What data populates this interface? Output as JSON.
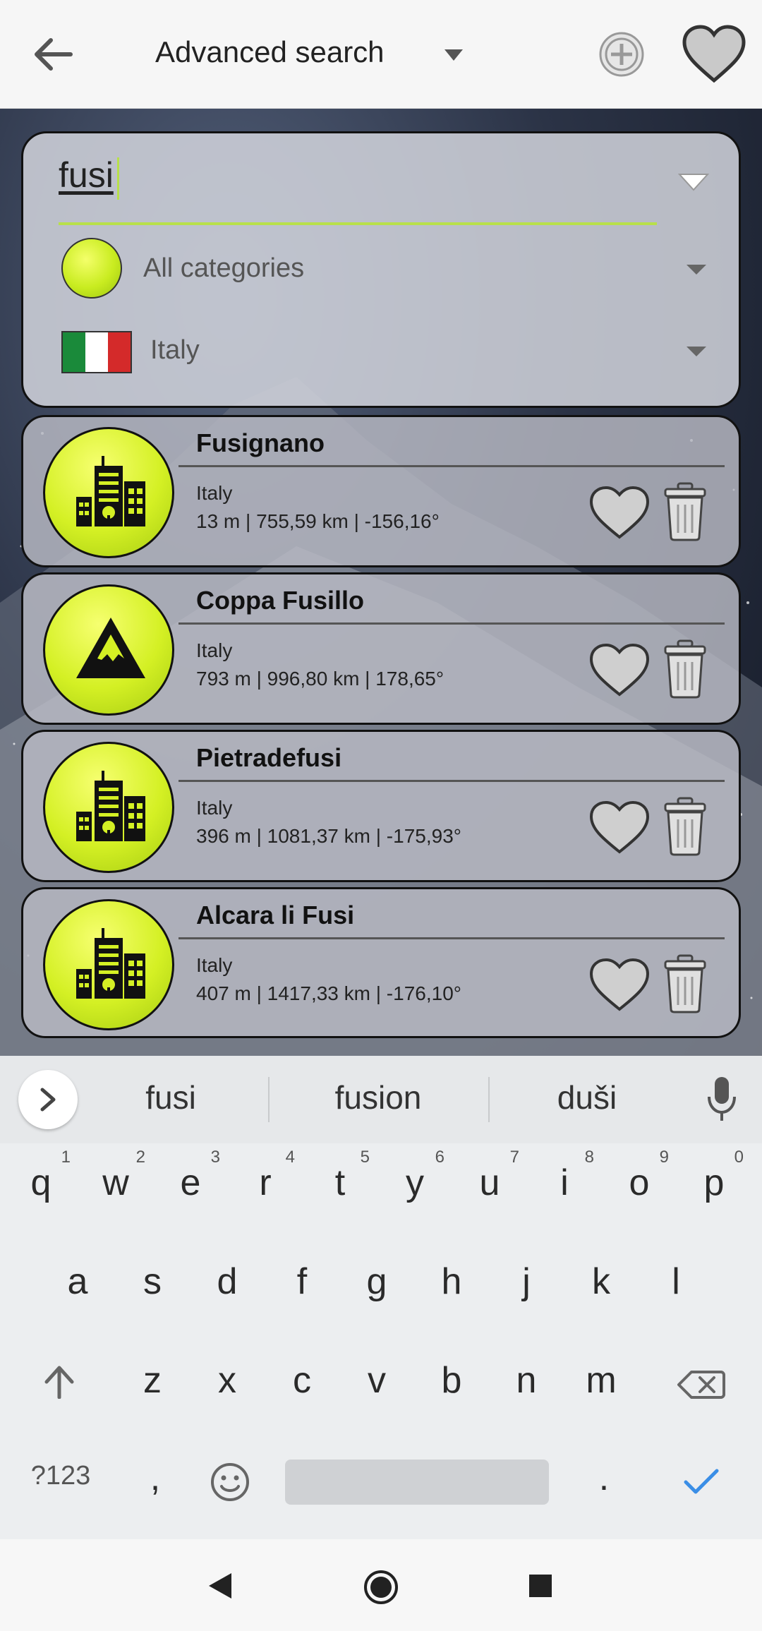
{
  "appbar": {
    "title": "Advanced search",
    "icons": [
      "back-arrow-icon",
      "caret-down-icon",
      "add-circle-icon",
      "heart-icon"
    ]
  },
  "search": {
    "query": "fusi",
    "category": "All categories",
    "country": "Italy",
    "accent_color": "#b8e04a"
  },
  "results": [
    {
      "name": "Fusignano",
      "country": "Italy",
      "details": "13 m | 755,59 km | -156,16°",
      "icon": "city-icon"
    },
    {
      "name": "Coppa Fusillo",
      "country": "Italy",
      "details": "793 m | 996,80 km | 178,65°",
      "icon": "mountain-icon"
    },
    {
      "name": "Pietradefusi",
      "country": "Italy",
      "details": "396 m | 1081,37 km | -175,93°",
      "icon": "city-icon"
    },
    {
      "name": "Alcara li Fusi",
      "country": "Italy",
      "details": "407 m | 1417,33 km | -176,10°",
      "icon": "city-icon"
    }
  ],
  "keyboard": {
    "suggestions": [
      "fusi",
      "fusion",
      "duši"
    ],
    "row1": [
      "q",
      "w",
      "e",
      "r",
      "t",
      "y",
      "u",
      "i",
      "o",
      "p"
    ],
    "row1_nums": [
      "1",
      "2",
      "3",
      "4",
      "5",
      "6",
      "7",
      "8",
      "9",
      "0"
    ],
    "row2": [
      "a",
      "s",
      "d",
      "f",
      "g",
      "h",
      "j",
      "k",
      "l"
    ],
    "row3": [
      "z",
      "x",
      "c",
      "v",
      "b",
      "n",
      "m"
    ],
    "symbols_key": "?123",
    "comma_key": ",",
    "period_key": "."
  }
}
